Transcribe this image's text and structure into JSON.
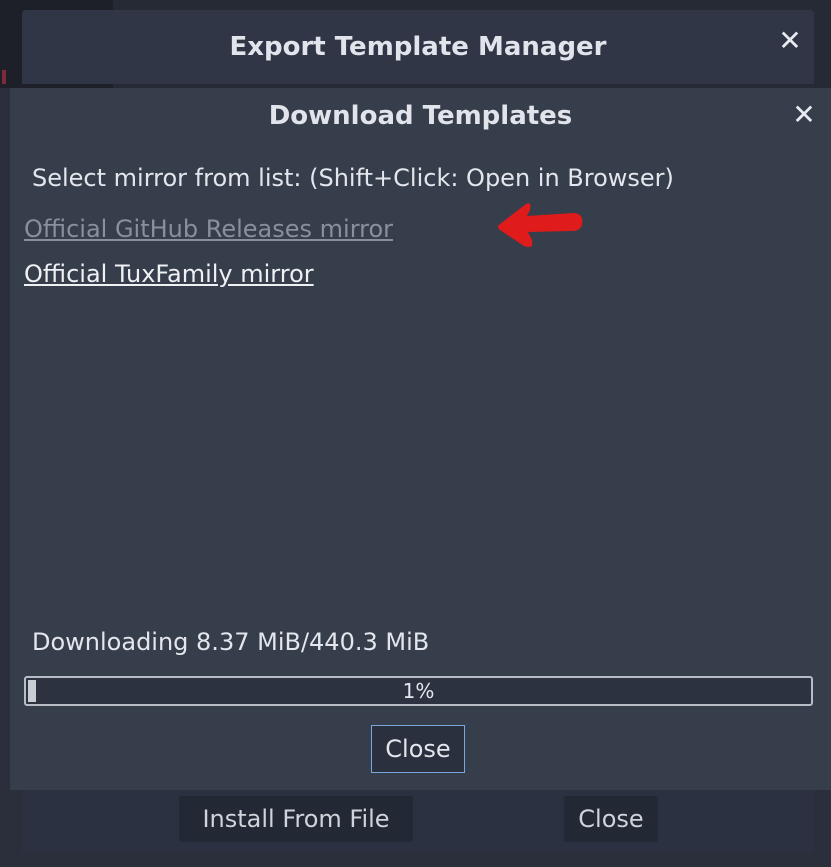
{
  "outer_window": {
    "title": "Export Template Manager",
    "install_button": "Install From File",
    "close_button": "Close"
  },
  "dialog": {
    "title": "Download Templates",
    "instructions": "Select mirror from list: (Shift+Click: Open in Browser)",
    "mirrors": [
      {
        "label": "Official GitHub Releases mirror"
      },
      {
        "label": "Official TuxFamily mirror"
      }
    ],
    "status": "Downloading 8.37 MiB/440.3 MiB",
    "progress": {
      "text": "1%",
      "value": 0.01
    },
    "close_button": "Close"
  },
  "icons": {
    "window_close": "close-icon",
    "annotation": "red-arrow-icon"
  },
  "colors": {
    "annotation_arrow": "#e01b1b",
    "focus_border": "#7aa6da"
  }
}
